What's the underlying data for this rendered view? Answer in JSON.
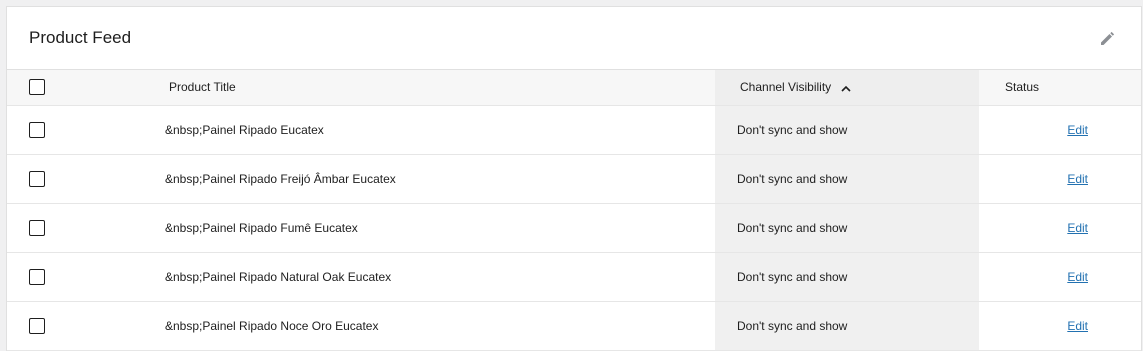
{
  "header": {
    "title": "Product Feed"
  },
  "table": {
    "columns": {
      "title": "Product Title",
      "channel_visibility": "Channel Visibility",
      "status": "Status"
    },
    "rows": [
      {
        "title": "&nbsp;Painel Ripado Eucatex",
        "visibility": "Don't sync and show",
        "action": "Edit"
      },
      {
        "title": "&nbsp;Painel Ripado Freijó Âmbar Eucatex",
        "visibility": "Don't sync and show",
        "action": "Edit"
      },
      {
        "title": "&nbsp;Painel Ripado Fumê Eucatex",
        "visibility": "Don't sync and show",
        "action": "Edit"
      },
      {
        "title": "&nbsp;Painel Ripado Natural Oak Eucatex",
        "visibility": "Don't sync and show",
        "action": "Edit"
      },
      {
        "title": "&nbsp;Painel Ripado Noce Oro Eucatex",
        "visibility": "Don't sync and show",
        "action": "Edit"
      }
    ]
  },
  "colors": {
    "link": "#2271b1",
    "sorted_column_bg": "#f0f0f0"
  },
  "icons": {
    "header_action": "pencil-icon",
    "sort": "chevron-up-icon"
  }
}
